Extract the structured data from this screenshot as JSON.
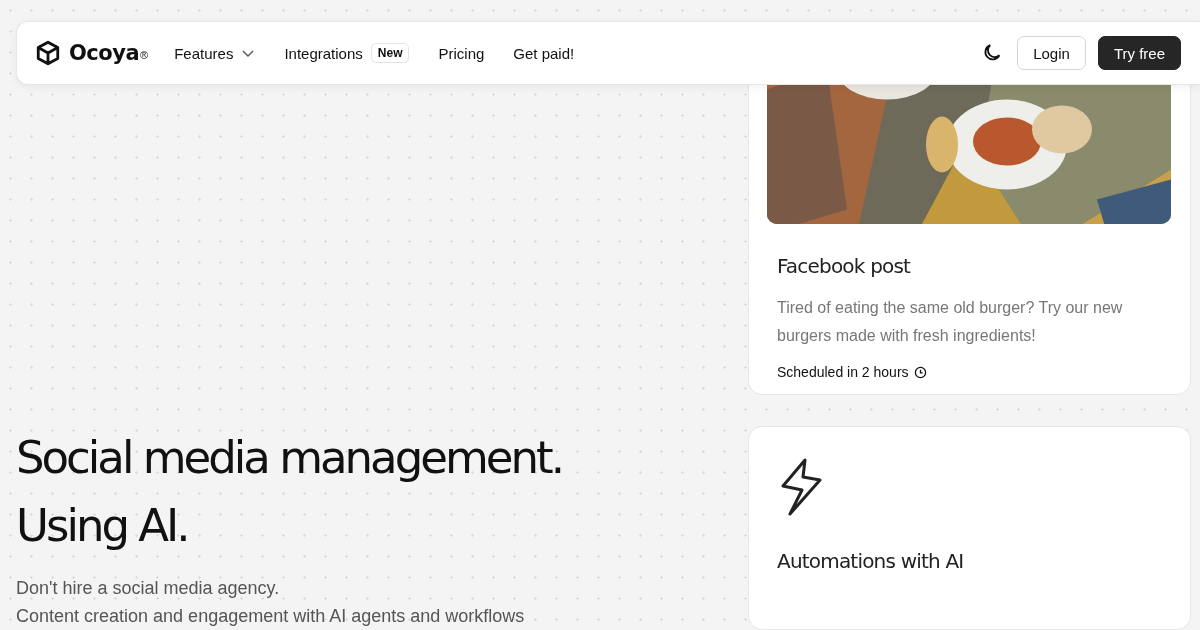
{
  "nav": {
    "logo": "Ocoya",
    "logo_mark": "®",
    "links": [
      {
        "label": "Features",
        "kind": "dropdown"
      },
      {
        "label": "Integrations",
        "kind": "badge",
        "badge": "New"
      },
      {
        "label": "Pricing",
        "kind": "plain"
      },
      {
        "label": "Get paid!",
        "kind": "plain"
      }
    ],
    "login": "Login",
    "cta": "Try free"
  },
  "hero": {
    "title_lines": [
      "Social media management.",
      "Using AI."
    ],
    "subtitle_lines": [
      "Don't hire a social media agency.",
      "Content creation and engagement with AI agents and workflows"
    ]
  },
  "cards": [
    {
      "kind": "post",
      "title": "Facebook post",
      "text": "Tired of eating the same old burger? Try our new burgers made with fresh ingredients!",
      "status": "Scheduled in 2 hours"
    },
    {
      "kind": "feature",
      "title": "Automations with AI"
    }
  ]
}
